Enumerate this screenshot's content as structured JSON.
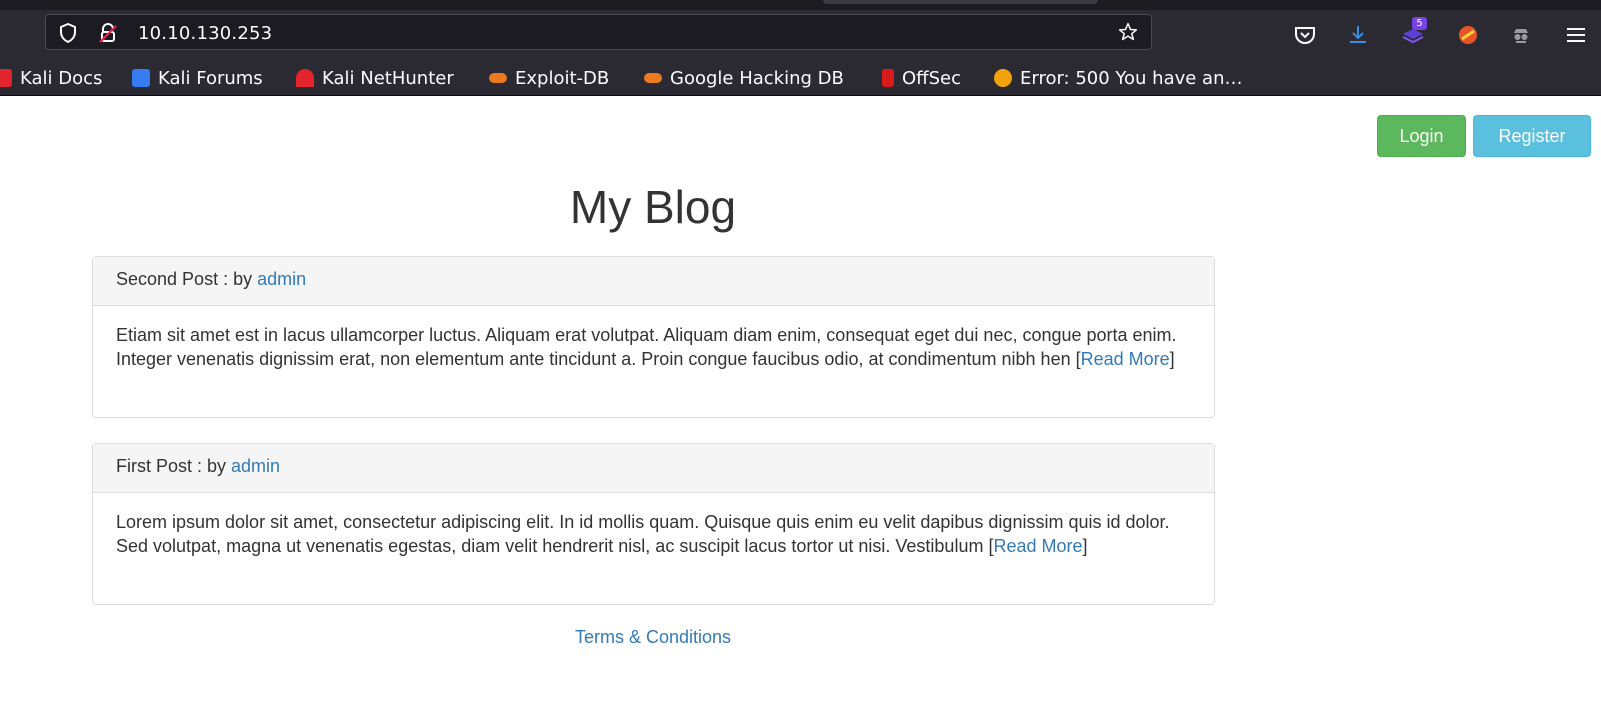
{
  "browser": {
    "url": "10.10.130.253",
    "downloads_badge": "5",
    "bookmarks": [
      {
        "label": "Kali Docs",
        "color": "#e2252c"
      },
      {
        "label": "Kali Forums",
        "color": "#367bf0"
      },
      {
        "label": "Kali NetHunter",
        "color": "#e2252c"
      },
      {
        "label": "Exploit-DB",
        "color": "#ec7a1e"
      },
      {
        "label": "Google Hacking DB",
        "color": "#ec7a1e"
      },
      {
        "label": "OffSec",
        "color": "#d81c1c"
      },
      {
        "label": "Error: 500 You have an…",
        "color": "#f0a30a"
      }
    ]
  },
  "header": {
    "login_label": "Login",
    "register_label": "Register"
  },
  "page": {
    "title": "My Blog"
  },
  "posts": [
    {
      "title": "Second Post : by ",
      "author": "admin",
      "body": "Etiam sit amet est in lacus ullamcorper luctus. Aliquam erat volutpat. Aliquam diam enim, consequat eget dui nec, congue porta enim. Integer venenatis dignissim erat, non elementum ante tincidunt a. Proin congue faucibus odio, at condimentum nibh hen [",
      "read_more": "Read More",
      "close": "]"
    },
    {
      "title": "First Post : by ",
      "author": "admin",
      "body": "Lorem ipsum dolor sit amet, consectetur adipiscing elit. In id mollis quam. Quisque quis enim eu velit dapibus dignissim quis id dolor. Sed volutpat, magna ut venenatis egestas, diam velit hendrerit nisl, ac suscipit lacus tortor ut nisi. Vestibulum [",
      "read_more": "Read More",
      "close": "]"
    }
  ],
  "footer": {
    "terms_label": "Terms & Conditions"
  },
  "colors": {
    "login": "#5cb85c",
    "register": "#5bc0de",
    "link": "#337ab7"
  }
}
